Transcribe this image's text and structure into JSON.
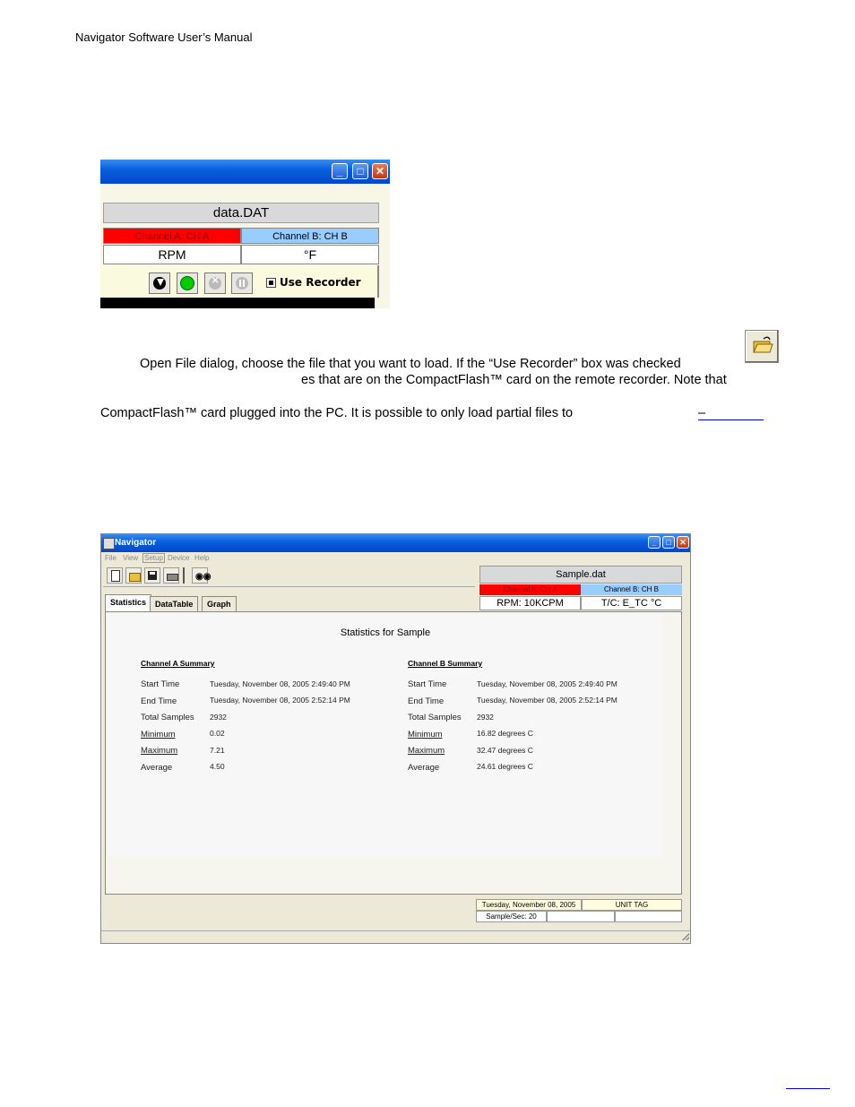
{
  "header": "Navigator Software User’s Manual",
  "screenshot1": {
    "filename": "data.DAT",
    "channel_a": "Channel A: CH A",
    "channel_b": "Channel B: CH B",
    "unit_a": "RPM",
    "unit_b": "°F",
    "use_recorder": "Use Recorder",
    "window_buttons": [
      "minimize-icon",
      "maximize-icon",
      "close-icon"
    ],
    "tool_buttons": [
      "download-icon",
      "record-icon",
      "stop-icon",
      "pause-icon"
    ],
    "colors": {
      "channel_a": "#ff0000",
      "channel_b": "#99ccff",
      "titlebar": "#0a5fe0"
    }
  },
  "body": {
    "line1": "Open File dialog, choose the file that you want to load. If the “Use Recorder” box was checked",
    "line2": "es that are on the CompactFlash™ card on the remote recorder. Note that",
    "line3": "CompactFlash™ card plugged into the PC. It is possible to only load partial files to",
    "line3_dash": "–"
  },
  "screenshot2": {
    "title": "Navigator",
    "menu": [
      "File",
      "View",
      "Setup",
      "Device",
      "Help"
    ],
    "toolbar": [
      "new-icon",
      "open-icon",
      "save-icon",
      "print-icon",
      "find-icon"
    ],
    "filename": "Sample.dat",
    "channel_a": "Channel A: CH A",
    "channel_b": "Channel B: CH B",
    "unit_a": "RPM: 10KCPM",
    "unit_b": "T/C: E_TC  °C",
    "tabs": [
      "Statistics",
      "DataTable",
      "Graph"
    ],
    "heading": "Statistics for Sample",
    "labels": [
      "Start Time",
      "End Time",
      "Total Samples",
      "Minimum",
      "Maximum",
      "Average"
    ],
    "channel_a_summary": {
      "title": "Channel A Summary",
      "values": [
        "Tuesday, November 08, 2005 2:49:40 PM",
        "Tuesday, November 08, 2005 2:52:14 PM",
        "2932",
        "0.02",
        "7.21",
        "4.50"
      ]
    },
    "channel_b_summary": {
      "title": "Channel B Summary",
      "values": [
        "Tuesday, November 08, 2005 2:49:40 PM",
        "Tuesday, November 08, 2005 2:52:14 PM",
        "2932",
        "16.82 degrees C",
        "32.47 degrees C",
        "24.61 degrees C"
      ]
    },
    "status": {
      "date": "Tuesday, November 08, 2005",
      "unit_tag": "UNIT TAG",
      "rate": "Sample/Sec: 20"
    }
  }
}
